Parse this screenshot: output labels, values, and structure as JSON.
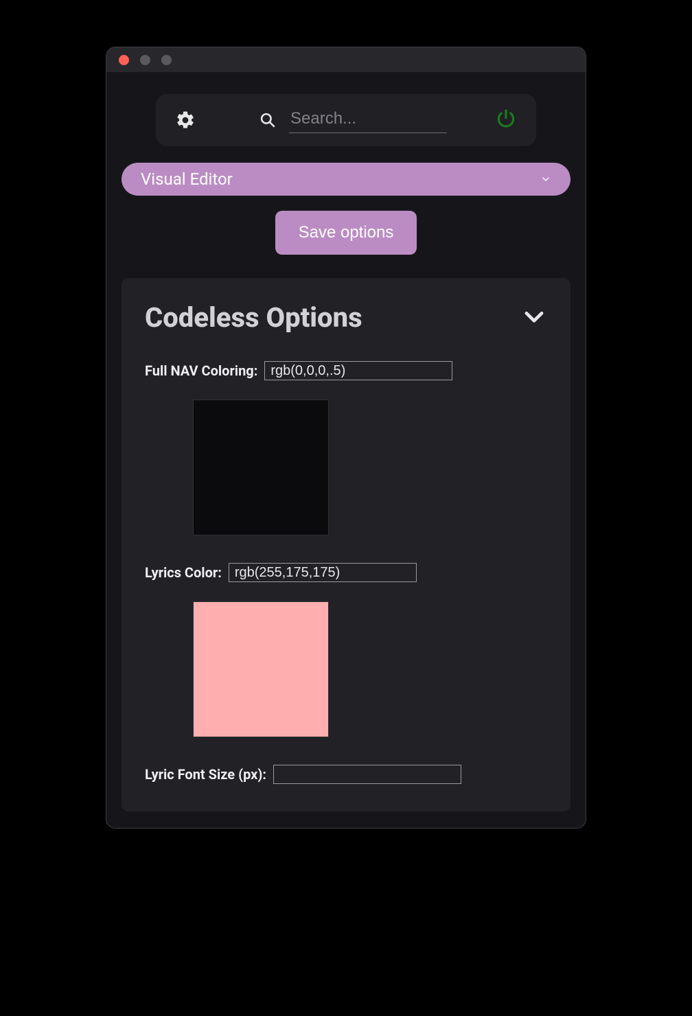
{
  "toolbar": {
    "search_placeholder": "Search..."
  },
  "dropdown": {
    "label": "Visual Editor"
  },
  "save_button_label": "Save options",
  "panel": {
    "title": "Codeless Options",
    "fields": {
      "nav_color": {
        "label": "Full NAV Coloring:",
        "value": "rgb(0,0,0,.5)",
        "swatch_css": "#0b0b0d"
      },
      "lyrics_color": {
        "label": "Lyrics Color:",
        "value": "rgb(255,175,175)",
        "swatch_css": "#ffafaf"
      },
      "lyric_font_size": {
        "label": "Lyric Font Size (px):",
        "value": ""
      }
    }
  },
  "colors": {
    "accent": "#bb8cc3",
    "power_icon": "#1c7a1c"
  }
}
